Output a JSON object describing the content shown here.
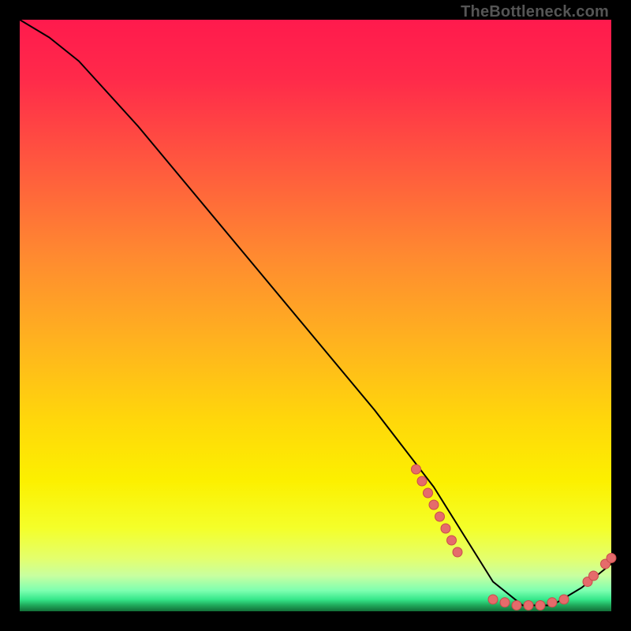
{
  "watermark": "TheBottleneck.com",
  "colors": {
    "background": "#000000",
    "curve": "#000000",
    "marker_fill": "#e56b6b",
    "marker_stroke": "#c94b4b",
    "gradient_top": "#ff1a4d",
    "gradient_mid": "#ffd80a",
    "gradient_bottom": "#136e38"
  },
  "chart_data": {
    "type": "line",
    "xlabel": "",
    "ylabel": "",
    "xlim": [
      0,
      100
    ],
    "ylim": [
      0,
      100
    ],
    "series": [
      {
        "name": "bottleneck-curve",
        "x": [
          0,
          5,
          10,
          20,
          30,
          40,
          50,
          60,
          70,
          75,
          80,
          85,
          90,
          95,
          100
        ],
        "values": [
          100,
          97,
          93,
          82,
          70,
          58,
          46,
          34,
          21,
          13,
          5,
          1,
          1,
          4,
          8
        ]
      }
    ],
    "markers": [
      {
        "name": "cluster-descending",
        "points": [
          {
            "x": 67,
            "y": 24
          },
          {
            "x": 68,
            "y": 22
          },
          {
            "x": 69,
            "y": 20
          },
          {
            "x": 70,
            "y": 18
          },
          {
            "x": 71,
            "y": 16
          },
          {
            "x": 72,
            "y": 14
          },
          {
            "x": 73,
            "y": 12
          },
          {
            "x": 74,
            "y": 10
          }
        ]
      },
      {
        "name": "cluster-bottom",
        "points": [
          {
            "x": 80,
            "y": 2
          },
          {
            "x": 82,
            "y": 1.5
          },
          {
            "x": 84,
            "y": 1
          },
          {
            "x": 86,
            "y": 1
          },
          {
            "x": 88,
            "y": 1
          },
          {
            "x": 90,
            "y": 1.5
          },
          {
            "x": 92,
            "y": 2
          }
        ]
      },
      {
        "name": "cluster-rising",
        "points": [
          {
            "x": 96,
            "y": 5
          },
          {
            "x": 97,
            "y": 6
          },
          {
            "x": 99,
            "y": 8
          },
          {
            "x": 100,
            "y": 9
          }
        ]
      }
    ]
  }
}
